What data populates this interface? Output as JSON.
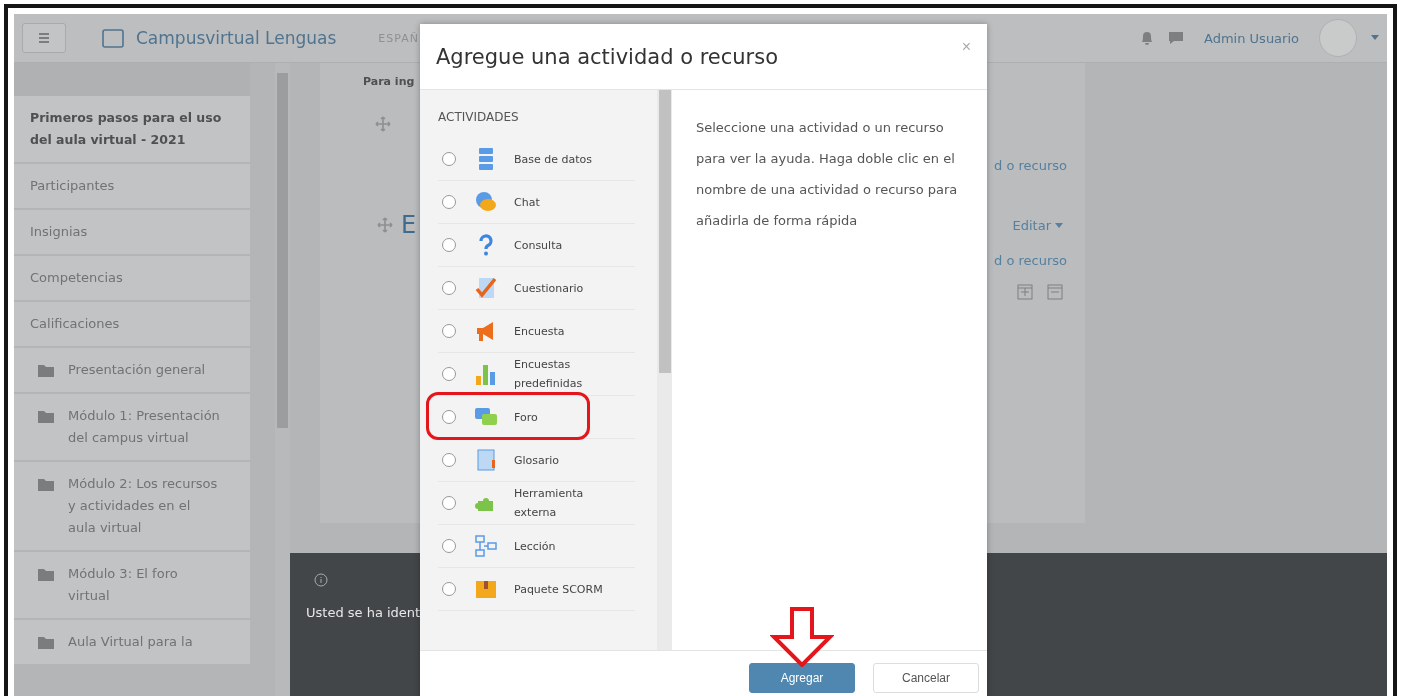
{
  "navbar": {
    "brand": "Campusvirtual Lenguas",
    "language": "ESPAÑ",
    "user": "Admin Usuario"
  },
  "sidebar": {
    "items": [
      {
        "kind": "course",
        "label": "Primeros pasos para el uso del aula virtual - 2021"
      },
      {
        "kind": "link",
        "label": "Participantes"
      },
      {
        "kind": "link",
        "label": "Insignias"
      },
      {
        "kind": "link",
        "label": "Competencias"
      },
      {
        "kind": "link",
        "label": "Calificaciones"
      },
      {
        "kind": "section",
        "label": "Presentación general"
      },
      {
        "kind": "section",
        "label": "Módulo 1: Presentación del campus virtual"
      },
      {
        "kind": "section",
        "label": "Módulo 2: Los recursos y actividades en el aula virtual"
      },
      {
        "kind": "section",
        "label": "Módulo 3: El foro virtual"
      },
      {
        "kind": "section",
        "label": "Aula Virtual para la"
      }
    ]
  },
  "course": {
    "heading": "Para ing",
    "section_title": "E",
    "add_links": [
      "d o recurso",
      "d o recurso"
    ],
    "edit_menu": "Editar"
  },
  "footer": {
    "login_text": "Usted se ha ident"
  },
  "modal": {
    "title": "Agregue una actividad o recurso",
    "close": "×",
    "section": "ACTIVIDADES",
    "activities": [
      {
        "label": "Base de datos",
        "kind": "database",
        "selected": false,
        "highlighted": false
      },
      {
        "label": "Chat",
        "kind": "chat",
        "selected": false,
        "highlighted": false
      },
      {
        "label": "Consulta",
        "kind": "question",
        "selected": false,
        "highlighted": false
      },
      {
        "label": "Cuestionario",
        "kind": "quiz",
        "selected": false,
        "highlighted": false
      },
      {
        "label": "Encuesta",
        "kind": "megaphone",
        "selected": false,
        "highlighted": false
      },
      {
        "label": "Encuestas predefinidas",
        "kind": "barchart",
        "selected": false,
        "highlighted": false
      },
      {
        "label": "Foro",
        "kind": "forum",
        "selected": false,
        "highlighted": true
      },
      {
        "label": "Glosario",
        "kind": "glossary",
        "selected": false,
        "highlighted": false
      },
      {
        "label": "Herramienta externa",
        "kind": "puzzle",
        "selected": false,
        "highlighted": false
      },
      {
        "label": "Lección",
        "kind": "lesson",
        "selected": false,
        "highlighted": false
      },
      {
        "label": "Paquete SCORM",
        "kind": "package",
        "selected": false,
        "highlighted": false
      }
    ],
    "help": "Seleccione una actividad o un recurso para ver la ayuda. Haga doble clic en el nombre de una actividad o recurso para añadirla de forma rápida",
    "buttons": [
      {
        "label": "Agregar",
        "kind": "primary",
        "pointed": true
      },
      {
        "label": "Cancelar",
        "kind": "secondary",
        "pointed": false
      }
    ]
  }
}
